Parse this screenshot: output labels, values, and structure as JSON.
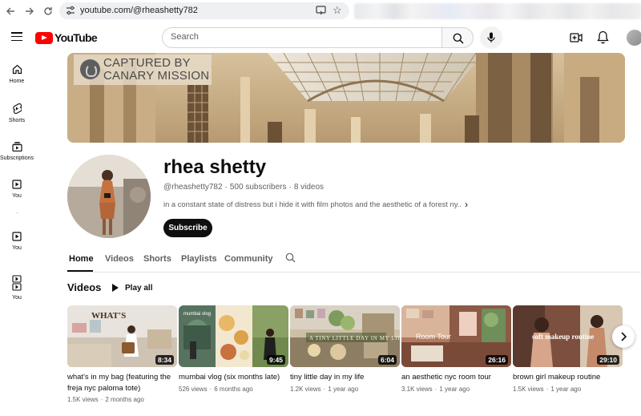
{
  "browser": {
    "url": "youtube.com/@rheashetty782",
    "back_icon": "arrow-left-icon",
    "forward_icon": "arrow-right-icon",
    "reload_icon": "reload-icon"
  },
  "masthead": {
    "logo_text": "YouTube",
    "search_placeholder": "Search",
    "brand_color": "#ff0000"
  },
  "guide": [
    {
      "label": "Home",
      "icon": "home-icon"
    },
    {
      "label": "Shorts",
      "icon": "shorts-icon"
    },
    {
      "label": "Subscriptions",
      "icon": "subscriptions-icon"
    },
    {
      "label": "You",
      "icon": "you-icon"
    },
    {
      "label": "You",
      "icon": "history-icon"
    },
    {
      "label": "You",
      "icon": "playlist-icon"
    }
  ],
  "banner": {
    "badge_line1": "CAPTURED BY",
    "badge_line2": "CANARY MISSION"
  },
  "channel": {
    "name": "rhea shetty",
    "handle": "@rheashetty782",
    "subscribers": "500 subscribers",
    "videos_count": "8 videos",
    "description": "in a constant state of distress but i hide it with film photos and the aesthetic of a forest ny...",
    "subscribe_label": "Subscribe"
  },
  "tabs": [
    "Home",
    "Videos",
    "Shorts",
    "Playlists",
    "Community"
  ],
  "active_tab": "Home",
  "videos_section": {
    "title": "Videos",
    "play_all_label": "Play all"
  },
  "videos": [
    {
      "title": "what's in my bag (featuring the freja nyc paloma tote)",
      "views": "1.5K views",
      "age": "2 months ago",
      "duration": "8:34"
    },
    {
      "title": "mumbai vlog (six months late)",
      "views": "526 views",
      "age": "6 months ago",
      "duration": "9:45"
    },
    {
      "title": "tiny little day in my life",
      "views": "1.2K views",
      "age": "1 year ago",
      "duration": "6:04"
    },
    {
      "title": "an aesthetic nyc room tour",
      "views": "3.1K views",
      "age": "1 year ago",
      "duration": "26:16"
    },
    {
      "title": "brown girl makeup routine",
      "views": "1.5K views",
      "age": "1 year ago",
      "duration": "29:10"
    }
  ],
  "thumbnail_overlays": [
    "WHAT'S",
    "mumbai vlog",
    "A TINY LITTLE DAY IN MY LIFE",
    "Room Tour",
    "soft makeup routine"
  ]
}
